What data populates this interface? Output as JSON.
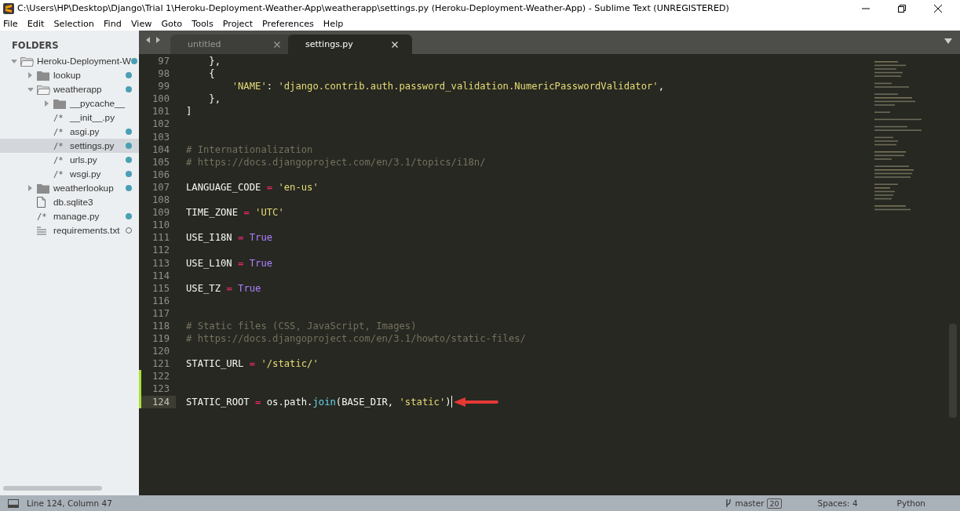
{
  "window": {
    "title": "C:\\Users\\HP\\Desktop\\Django\\Trial 1\\Heroku-Deployment-Weather-App\\weatherapp\\settings.py (Heroku-Deployment-Weather-App) - Sublime Text (UNREGISTERED)"
  },
  "menu": [
    "File",
    "Edit",
    "Selection",
    "Find",
    "View",
    "Goto",
    "Tools",
    "Project",
    "Preferences",
    "Help"
  ],
  "sidebar": {
    "heading": "FOLDERS",
    "items": [
      {
        "kind": "folder",
        "label": "Heroku-Deployment-W",
        "expanded": true,
        "selected": false,
        "modified": true,
        "untracked": false,
        "children": [
          {
            "kind": "folder",
            "label": "lookup",
            "expanded": false,
            "selected": false,
            "modified": true,
            "untracked": false
          },
          {
            "kind": "folder",
            "label": "weatherapp",
            "expanded": true,
            "selected": false,
            "modified": true,
            "untracked": false,
            "children": [
              {
                "kind": "folder",
                "label": "__pycache__",
                "expanded": false,
                "selected": false,
                "modified": false,
                "untracked": false
              },
              {
                "kind": "code",
                "icon": "/*",
                "label": "__init__.py",
                "selected": false,
                "modified": false,
                "untracked": false
              },
              {
                "kind": "code",
                "icon": "/*",
                "label": "asgi.py",
                "selected": false,
                "modified": true,
                "untracked": false
              },
              {
                "kind": "code",
                "icon": "/*",
                "label": "settings.py",
                "selected": true,
                "modified": true,
                "untracked": false
              },
              {
                "kind": "code",
                "icon": "/*",
                "label": "urls.py",
                "selected": false,
                "modified": true,
                "untracked": false
              },
              {
                "kind": "code",
                "icon": "/*",
                "label": "wsgi.py",
                "selected": false,
                "modified": true,
                "untracked": false
              }
            ]
          },
          {
            "kind": "folder",
            "label": "weatherlookup",
            "expanded": false,
            "selected": false,
            "modified": true,
            "untracked": false
          },
          {
            "kind": "blank",
            "label": "db.sqlite3",
            "selected": false,
            "modified": false,
            "untracked": false
          },
          {
            "kind": "code",
            "icon": "/*",
            "label": "manage.py",
            "selected": false,
            "modified": true,
            "untracked": false
          },
          {
            "kind": "text",
            "label": "requirements.txt",
            "selected": false,
            "modified": false,
            "untracked": true
          }
        ]
      }
    ]
  },
  "tabs": [
    {
      "label": "untitled",
      "selected": false
    },
    {
      "label": "settings.py",
      "selected": true
    }
  ],
  "editor": {
    "lines": [
      {
        "number": "97",
        "modified": false,
        "current": false,
        "tokens": [
          {
            "kind": "text",
            "text": "    },"
          }
        ]
      },
      {
        "number": "98",
        "modified": false,
        "current": false,
        "tokens": [
          {
            "kind": "text",
            "text": "    {"
          }
        ]
      },
      {
        "number": "99",
        "modified": false,
        "current": false,
        "tokens": [
          {
            "kind": "string",
            "text": "        'NAME'"
          },
          {
            "kind": "text",
            "text": ": "
          },
          {
            "kind": "string",
            "text": "'django.contrib.auth.password_validation.NumericPasswordValidator'"
          },
          {
            "kind": "text",
            "text": ","
          }
        ]
      },
      {
        "number": "100",
        "modified": false,
        "current": false,
        "tokens": [
          {
            "kind": "text",
            "text": "    },"
          }
        ]
      },
      {
        "number": "101",
        "modified": false,
        "current": false,
        "tokens": [
          {
            "kind": "text",
            "text": "]"
          }
        ]
      },
      {
        "number": "102",
        "modified": false,
        "current": false
      },
      {
        "number": "103",
        "modified": false,
        "current": false
      },
      {
        "number": "104",
        "modified": false,
        "current": false,
        "tokens": [
          {
            "kind": "comment",
            "text": "# Internationalization"
          }
        ]
      },
      {
        "number": "105",
        "modified": false,
        "current": false,
        "tokens": [
          {
            "kind": "comment",
            "text": "# https://docs.djangoproject.com/en/3.1/topics/i18n/"
          }
        ]
      },
      {
        "number": "106",
        "modified": false,
        "current": false
      },
      {
        "number": "107",
        "modified": false,
        "current": false,
        "tokens": [
          {
            "kind": "text",
            "text": "LANGUAGE_CODE "
          },
          {
            "kind": "operator",
            "text": "="
          },
          {
            "kind": "string",
            "text": " 'en-us'"
          }
        ]
      },
      {
        "number": "108",
        "modified": false,
        "current": false
      },
      {
        "number": "109",
        "modified": false,
        "current": false,
        "tokens": [
          {
            "kind": "text",
            "text": "TIME_ZONE "
          },
          {
            "kind": "operator",
            "text": "="
          },
          {
            "kind": "string",
            "text": " 'UTC'"
          }
        ]
      },
      {
        "number": "110",
        "modified": false,
        "current": false
      },
      {
        "number": "111",
        "modified": false,
        "current": false,
        "tokens": [
          {
            "kind": "text",
            "text": "USE_I18N "
          },
          {
            "kind": "operator",
            "text": "="
          },
          {
            "kind": "constant",
            "text": " True"
          }
        ]
      },
      {
        "number": "112",
        "modified": false,
        "current": false
      },
      {
        "number": "113",
        "modified": false,
        "current": false,
        "tokens": [
          {
            "kind": "text",
            "text": "USE_L10N "
          },
          {
            "kind": "operator",
            "text": "="
          },
          {
            "kind": "constant",
            "text": " True"
          }
        ]
      },
      {
        "number": "114",
        "modified": false,
        "current": false
      },
      {
        "number": "115",
        "modified": false,
        "current": false,
        "tokens": [
          {
            "kind": "text",
            "text": "USE_TZ "
          },
          {
            "kind": "operator",
            "text": "="
          },
          {
            "kind": "constant",
            "text": " True"
          }
        ]
      },
      {
        "number": "116",
        "modified": false,
        "current": false
      },
      {
        "number": "117",
        "modified": false,
        "current": false
      },
      {
        "number": "118",
        "modified": false,
        "current": false,
        "tokens": [
          {
            "kind": "comment",
            "text": "# Static files (CSS, JavaScript, Images)"
          }
        ]
      },
      {
        "number": "119",
        "modified": false,
        "current": false,
        "tokens": [
          {
            "kind": "comment",
            "text": "# https://docs.djangoproject.com/en/3.1/howto/static-files/"
          }
        ]
      },
      {
        "number": "120",
        "modified": false,
        "current": false
      },
      {
        "number": "121",
        "modified": false,
        "current": false,
        "tokens": [
          {
            "kind": "text",
            "text": "STATIC_URL "
          },
          {
            "kind": "operator",
            "text": "="
          },
          {
            "kind": "string",
            "text": " '/static/'"
          }
        ]
      },
      {
        "number": "122",
        "modified": true,
        "current": false
      },
      {
        "number": "123",
        "modified": true,
        "current": false
      },
      {
        "number": "124",
        "modified": true,
        "current": true,
        "tokens": [
          {
            "kind": "text",
            "text": "STATIC_ROOT "
          },
          {
            "kind": "operator",
            "text": "="
          },
          {
            "kind": "text",
            "text": " os.path."
          },
          {
            "kind": "function",
            "text": "join"
          },
          {
            "kind": "text",
            "text": "(BASE_DIR, "
          },
          {
            "kind": "string",
            "text": "'static'"
          },
          {
            "kind": "text",
            "text": ")"
          }
        ]
      }
    ]
  },
  "status_bar": {
    "position": "Line 124, Column 47",
    "branch": "master",
    "branch_count": "20",
    "indentation": "Spaces: 4",
    "syntax": "Python"
  }
}
